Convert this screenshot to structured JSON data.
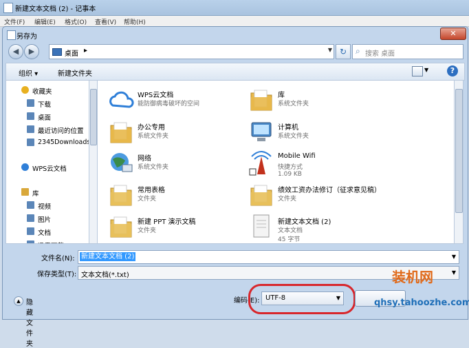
{
  "notepad": {
    "title": "新建文本文档 (2) - 记事本",
    "menu": [
      "文件(F)",
      "编辑(E)",
      "格式(O)",
      "查看(V)",
      "帮助(H)"
    ]
  },
  "dialog": {
    "title": "另存为",
    "close_label": "✕",
    "address": {
      "location": "桌面"
    },
    "search_placeholder": "搜索 桌面",
    "toolbar": {
      "organize": "组织 ▾",
      "new_folder": "新建文件夹"
    },
    "nav": [
      {
        "label": "收藏夹",
        "icon": "star-icon",
        "indent": 0
      },
      {
        "label": "下载",
        "icon": "download-folder-icon",
        "indent": 1
      },
      {
        "label": "桌面",
        "icon": "desktop-icon",
        "indent": 1
      },
      {
        "label": "最近访问的位置",
        "icon": "recent-places-icon",
        "indent": 1
      },
      {
        "label": "2345Downloads",
        "icon": "folder-icon",
        "indent": 1
      },
      {
        "label": "WPS云文档",
        "icon": "cloud-icon",
        "indent": 0
      },
      {
        "label": "库",
        "icon": "library-icon",
        "indent": 0
      },
      {
        "label": "视频",
        "icon": "video-library-icon",
        "indent": 1
      },
      {
        "label": "图片",
        "icon": "picture-library-icon",
        "indent": 1
      },
      {
        "label": "文档",
        "icon": "document-library-icon",
        "indent": 1
      },
      {
        "label": "迅雷下载",
        "icon": "thunder-download-icon",
        "indent": 1
      }
    ],
    "items": [
      {
        "name": "WPS云文档",
        "sub": "能防御病毒破坏的空间",
        "sub2": "",
        "icon": "cloud-icon",
        "color": "#2f7fd8"
      },
      {
        "name": "库",
        "sub": "系统文件夹",
        "sub2": "",
        "icon": "library-icon",
        "color": "#e8b84a"
      },
      {
        "name": "办公专用",
        "sub": "系统文件夹",
        "sub2": "",
        "icon": "user-folder-icon",
        "color": "#e8b84a"
      },
      {
        "name": "计算机",
        "sub": "系统文件夹",
        "sub2": "",
        "icon": "computer-icon",
        "color": "#4a89c8"
      },
      {
        "name": "网络",
        "sub": "系统文件夹",
        "sub2": "",
        "icon": "network-icon",
        "color": "#3a8c4a"
      },
      {
        "name": "Mobile Wifi",
        "sub": "快捷方式",
        "sub2": "1.09 KB",
        "icon": "wifi-shortcut-icon",
        "color": "#c2311c"
      },
      {
        "name": "常用表格",
        "sub": "文件夹",
        "sub2": "",
        "icon": "folder-icon",
        "color": "#e8c05a"
      },
      {
        "name": "绩效工资办法修订（征求意见稿）",
        "sub": "文件夹",
        "sub2": "",
        "icon": "folder-icon",
        "color": "#e8c05a"
      },
      {
        "name": "新建 PPT 演示文稿",
        "sub": "文件夹",
        "sub2": "",
        "icon": "folder-icon",
        "color": "#e8c05a"
      },
      {
        "name": "新建文本文档 (2)",
        "sub": "文本文档",
        "sub2": "45 字节",
        "icon": "text-document-icon",
        "color": "#f4f4f4"
      }
    ],
    "filename_label": "文件名(N):",
    "filename_value": "新建文本文档 (2)",
    "filetype_label": "保存类型(T):",
    "filetype_value": "文本文档(*.txt)",
    "hide_folders": "隐藏文件夹",
    "encoding_label": "编码(E):",
    "encoding_value": "UTF-8"
  },
  "watermark": {
    "brand": "装机网",
    "url": "qhsy.tahoozhe.com"
  },
  "colors": {
    "accent_highlight": "#d8262b",
    "selection": "#3399ff"
  }
}
